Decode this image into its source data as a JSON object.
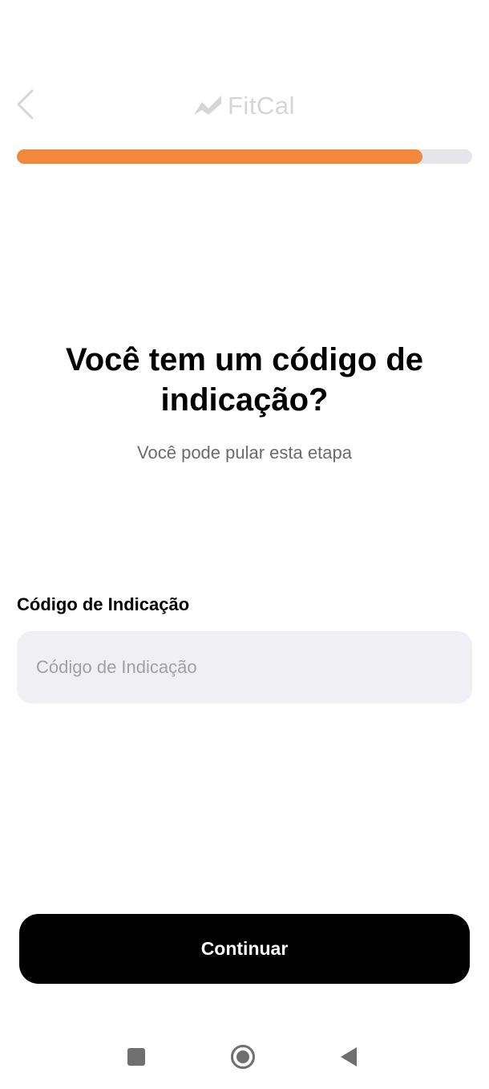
{
  "header": {
    "back_icon": "chevron-left-icon",
    "logo_icon": "trend-line-icon",
    "logo_text": "FitCal",
    "progress_fraction": 0.89,
    "progress_color": "#f0893c"
  },
  "main": {
    "title": "Você tem um código de indicação?",
    "subtitle": "Você pode pular esta etapa",
    "field_label": "Código de Indicação",
    "input_placeholder": "Código de Indicação",
    "input_value": ""
  },
  "actions": {
    "continue_label": "Continuar"
  },
  "system_nav": {
    "recents_icon": "square-icon",
    "home_icon": "circle-icon",
    "back_icon": "triangle-left-icon"
  }
}
